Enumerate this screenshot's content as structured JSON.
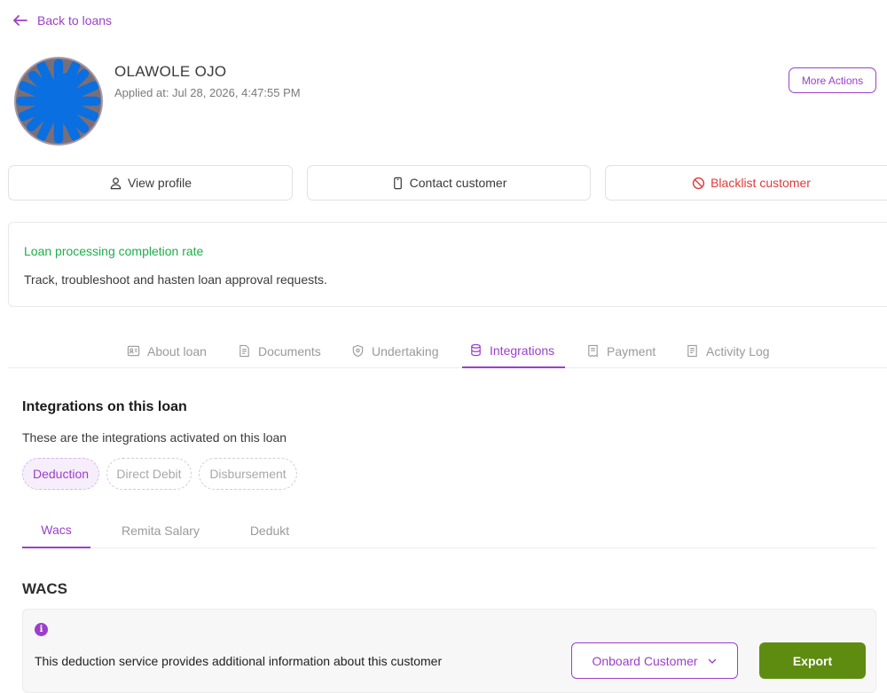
{
  "header": {
    "back_label": "Back to loans",
    "customer_name": "OLAWOLE OJO",
    "applied_at": "Applied at: Jul 28, 2026, 4:47:55 PM",
    "more_actions_label": "More Actions"
  },
  "actions": {
    "view_profile": "View profile",
    "contact_customer": "Contact customer",
    "blacklist_customer": "Blacklist customer"
  },
  "rate_card": {
    "title": "Loan processing completion rate",
    "description": "Track, troubleshoot and hasten loan approval requests."
  },
  "tabs": [
    {
      "label": "About loan",
      "icon": "id-card-icon"
    },
    {
      "label": "Documents",
      "icon": "document-icon"
    },
    {
      "label": "Undertaking",
      "icon": "shield-icon"
    },
    {
      "label": "Integrations",
      "icon": "database-icon",
      "active": true
    },
    {
      "label": "Payment",
      "icon": "receipt-icon"
    },
    {
      "label": "Activity Log",
      "icon": "log-icon"
    }
  ],
  "integrations": {
    "title": "Integrations on this loan",
    "description": "These are the integrations activated on this loan",
    "chips": [
      "Deduction",
      "Direct Debit",
      "Disbursement"
    ],
    "active_chip": "Deduction"
  },
  "sub_tabs": [
    "Wacs",
    "Remita Salary",
    "Dedukt"
  ],
  "active_sub_tab": "Wacs",
  "wacs": {
    "title": "WACS",
    "info_text": "This deduction service provides additional information about this customer",
    "onboard_label": "Onboard Customer",
    "export_label": "Export"
  },
  "colors": {
    "accent": "#9b3fc9",
    "success": "#1fae4b",
    "danger": "#e03b3b",
    "export": "#5e8c11"
  }
}
